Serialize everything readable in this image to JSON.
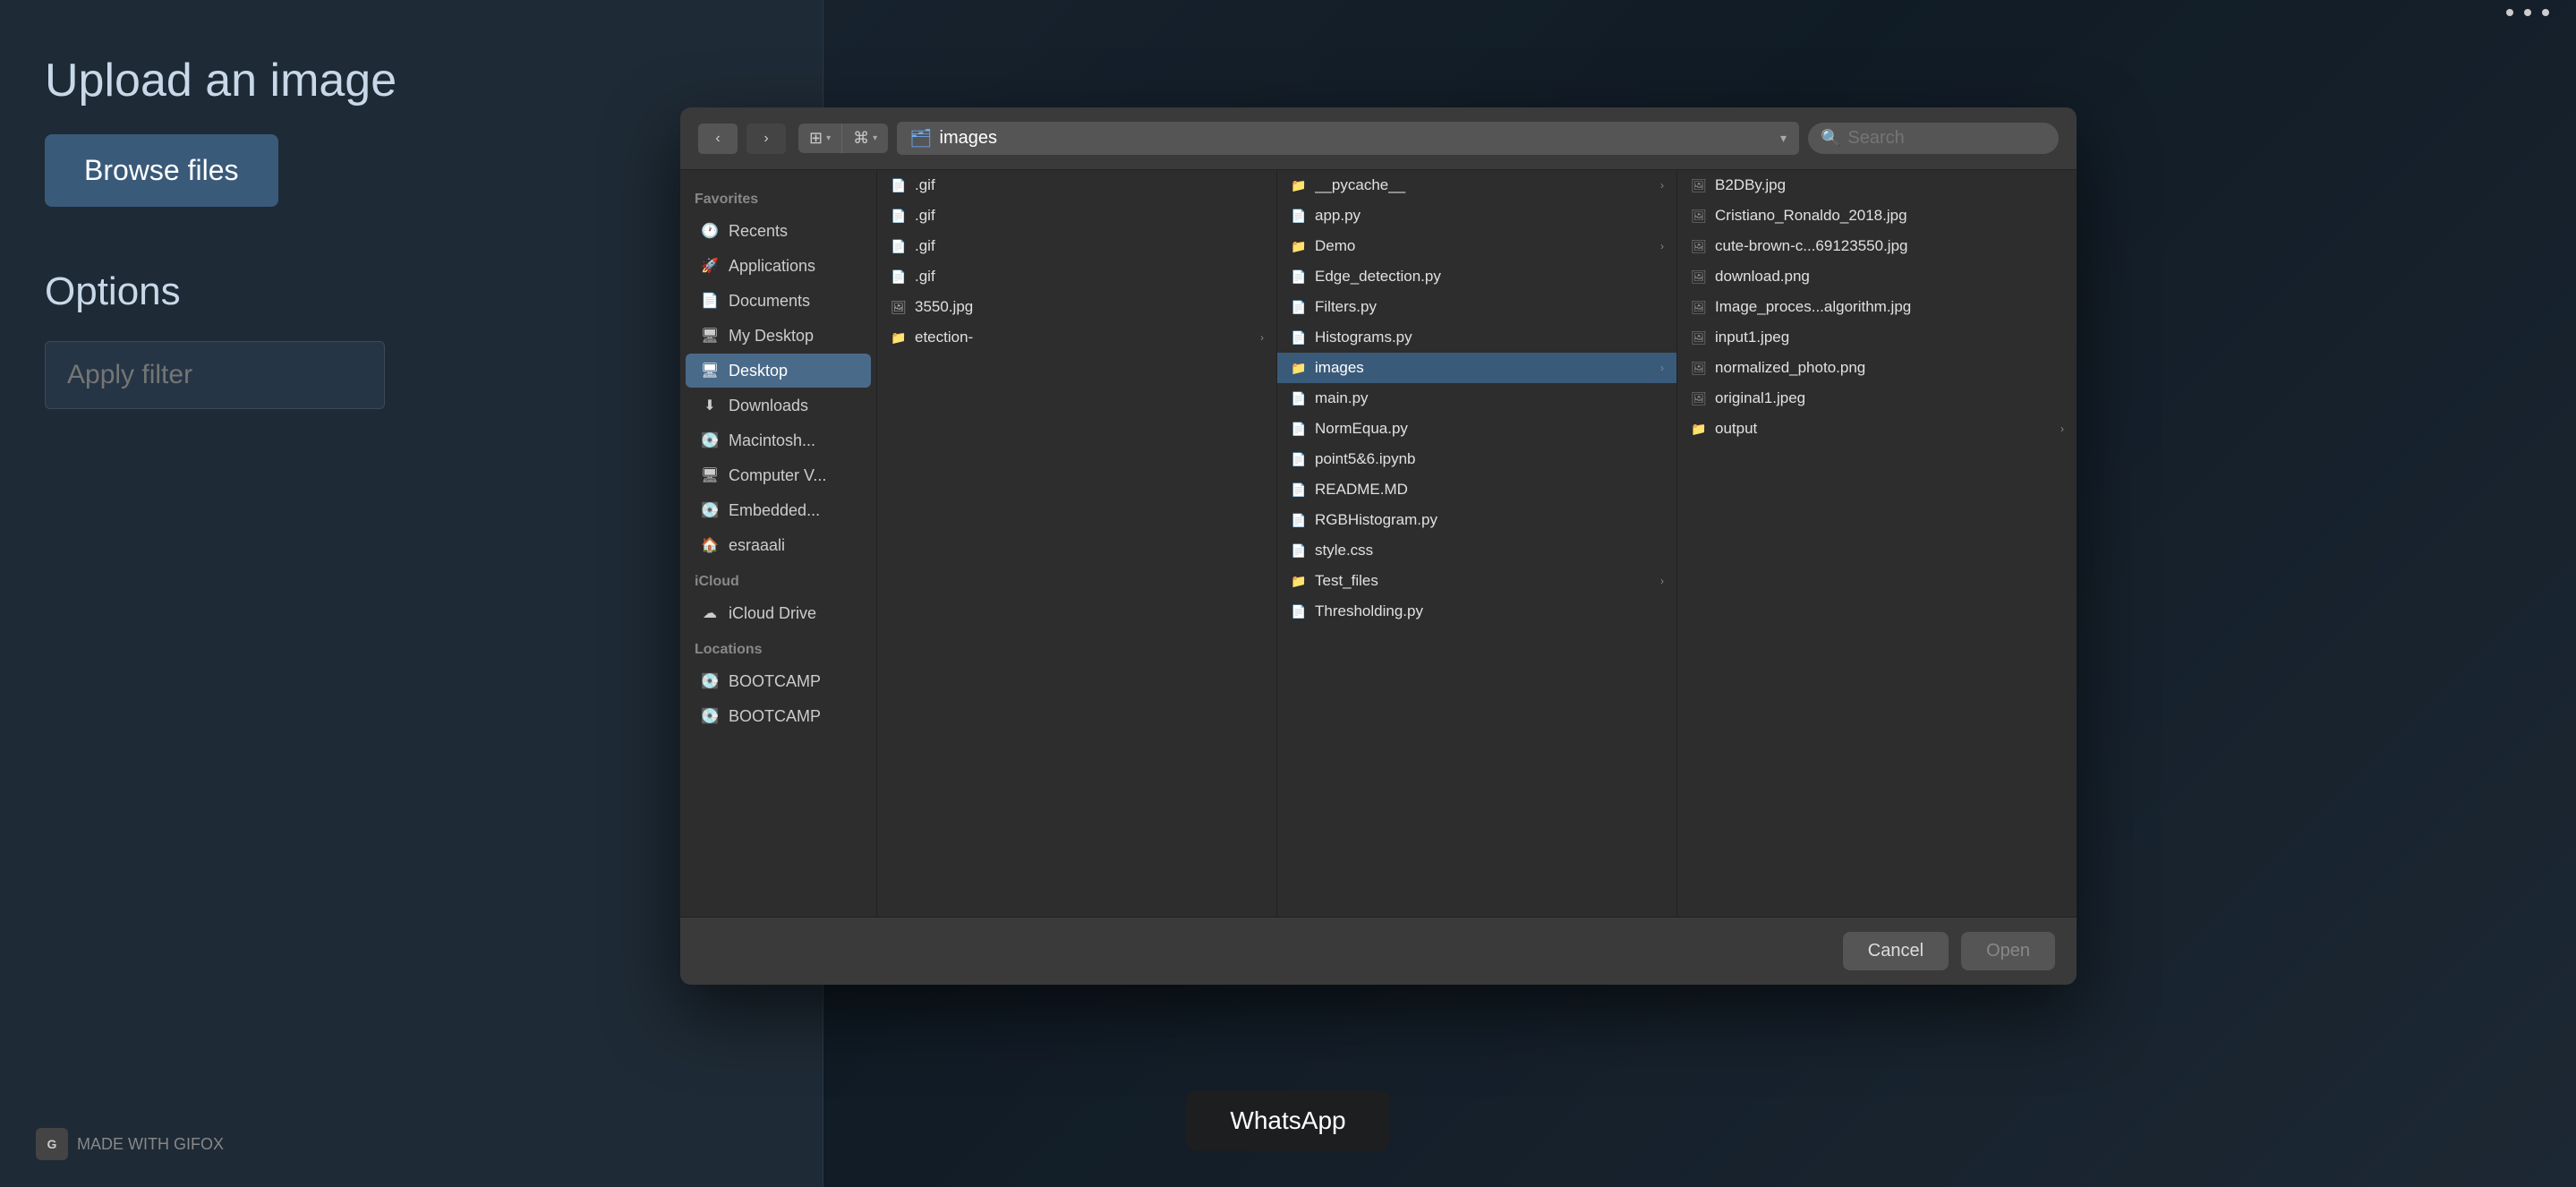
{
  "app": {
    "title": "Upload an image",
    "browse_label": "Browse files",
    "options_title": "Options",
    "filter_placeholder": "Apply filter"
  },
  "dialog": {
    "toolbar": {
      "back_title": "Back",
      "forward_title": "Forward",
      "view_columns_label": "⊞",
      "view_list_label": "⌘",
      "path": "images",
      "search_placeholder": "Search"
    },
    "footer": {
      "cancel_label": "Cancel",
      "open_label": "Open"
    }
  },
  "sidebar": {
    "favorites_label": "Favorites",
    "icloud_label": "iCloud",
    "locations_label": "Locations",
    "items": [
      {
        "id": "recents",
        "label": "Recents",
        "icon": "🕐"
      },
      {
        "id": "applications",
        "label": "Applications",
        "icon": "🚀"
      },
      {
        "id": "documents",
        "label": "Documents",
        "icon": "📄"
      },
      {
        "id": "desktop",
        "label": "My Desktop",
        "icon": "🖥"
      },
      {
        "id": "desktop2",
        "label": "Desktop",
        "icon": "🖥",
        "active": true
      },
      {
        "id": "downloads",
        "label": "Downloads",
        "icon": "⬇"
      },
      {
        "id": "macintosh",
        "label": "Macintosh...",
        "icon": "💽"
      },
      {
        "id": "computer",
        "label": "Computer V...",
        "icon": "🖥"
      },
      {
        "id": "embedded",
        "label": "Embedded...",
        "icon": "💽"
      },
      {
        "id": "esraaali",
        "label": "esraaali",
        "icon": "🏠"
      },
      {
        "id": "icloud",
        "label": "iCloud Drive",
        "icon": "☁"
      },
      {
        "id": "bootcamp1",
        "label": "BOOTCAMP",
        "icon": "💽"
      },
      {
        "id": "bootcamp2",
        "label": "BOOTCAMP",
        "icon": "💽"
      }
    ]
  },
  "pane1": {
    "items": [
      {
        "name": ".gif",
        "type": "file",
        "has_children": false
      },
      {
        "name": ".gif",
        "type": "file",
        "has_children": false
      },
      {
        "name": ".gif",
        "type": "file",
        "has_children": false
      },
      {
        "name": ".gif",
        "type": "file",
        "has_children": false
      },
      {
        "name": "3550.jpg",
        "type": "file",
        "has_children": false
      },
      {
        "name": "etection-",
        "type": "folder",
        "has_children": true
      }
    ]
  },
  "pane2": {
    "items": [
      {
        "name": "__pycache__",
        "type": "folder",
        "has_children": true
      },
      {
        "name": "app.py",
        "type": "file",
        "has_children": false
      },
      {
        "name": "Demo",
        "type": "folder",
        "has_children": true
      },
      {
        "name": "Edge_detection.py",
        "type": "file",
        "has_children": false
      },
      {
        "name": "Filters.py",
        "type": "file",
        "has_children": false
      },
      {
        "name": "Histograms.py",
        "type": "file",
        "has_children": false
      },
      {
        "name": "images",
        "type": "folder",
        "has_children": true,
        "selected": true
      },
      {
        "name": "main.py",
        "type": "file",
        "has_children": false
      },
      {
        "name": "NormEqua.py",
        "type": "file",
        "has_children": false
      },
      {
        "name": "point5&6.ipynb",
        "type": "file",
        "has_children": false
      },
      {
        "name": "README.MD",
        "type": "file",
        "has_children": false
      },
      {
        "name": "RGBHistogram.py",
        "type": "file",
        "has_children": false
      },
      {
        "name": "style.css",
        "type": "file",
        "has_children": false
      },
      {
        "name": "Test_files",
        "type": "folder",
        "has_children": true
      },
      {
        "name": "Thresholding.py",
        "type": "file",
        "has_children": false
      }
    ]
  },
  "pane3": {
    "items": [
      {
        "name": "B2DBy.jpg",
        "type": "image",
        "has_children": false
      },
      {
        "name": "Cristiano_Ronaldo_2018.jpg",
        "type": "image",
        "has_children": false
      },
      {
        "name": "cute-brown-c...69123550.jpg",
        "type": "image",
        "has_children": false
      },
      {
        "name": "download.png",
        "type": "image",
        "has_children": false
      },
      {
        "name": "Image_proces...algorithm.jpg",
        "type": "image",
        "has_children": false
      },
      {
        "name": "input1.jpeg",
        "type": "image",
        "has_children": false
      },
      {
        "name": "normalized_photo.png",
        "type": "image",
        "has_children": false
      },
      {
        "name": "original1.jpeg",
        "type": "image",
        "has_children": false
      },
      {
        "name": "output",
        "type": "folder",
        "has_children": true
      }
    ]
  },
  "taskbar": {
    "whatsapp_label": "WhatsApp"
  },
  "gifox": {
    "label": "MADE WITH GIFOX"
  }
}
